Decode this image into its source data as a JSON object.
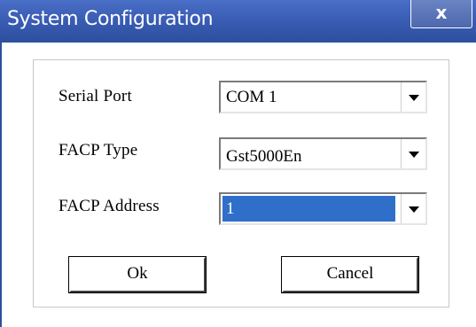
{
  "window": {
    "title": "System Configuration",
    "close_label": "x"
  },
  "form": {
    "serial_port": {
      "label": "Serial Port",
      "value": "COM 1"
    },
    "facp_type": {
      "label": "FACP Type",
      "value": "Gst5000En"
    },
    "facp_address": {
      "label": "FACP Address",
      "value": "1"
    }
  },
  "buttons": {
    "ok_label": "Ok",
    "cancel_label": "Cancel"
  },
  "colors": {
    "titlebar": "#3a5db5",
    "selection": "#2f6fc9"
  }
}
